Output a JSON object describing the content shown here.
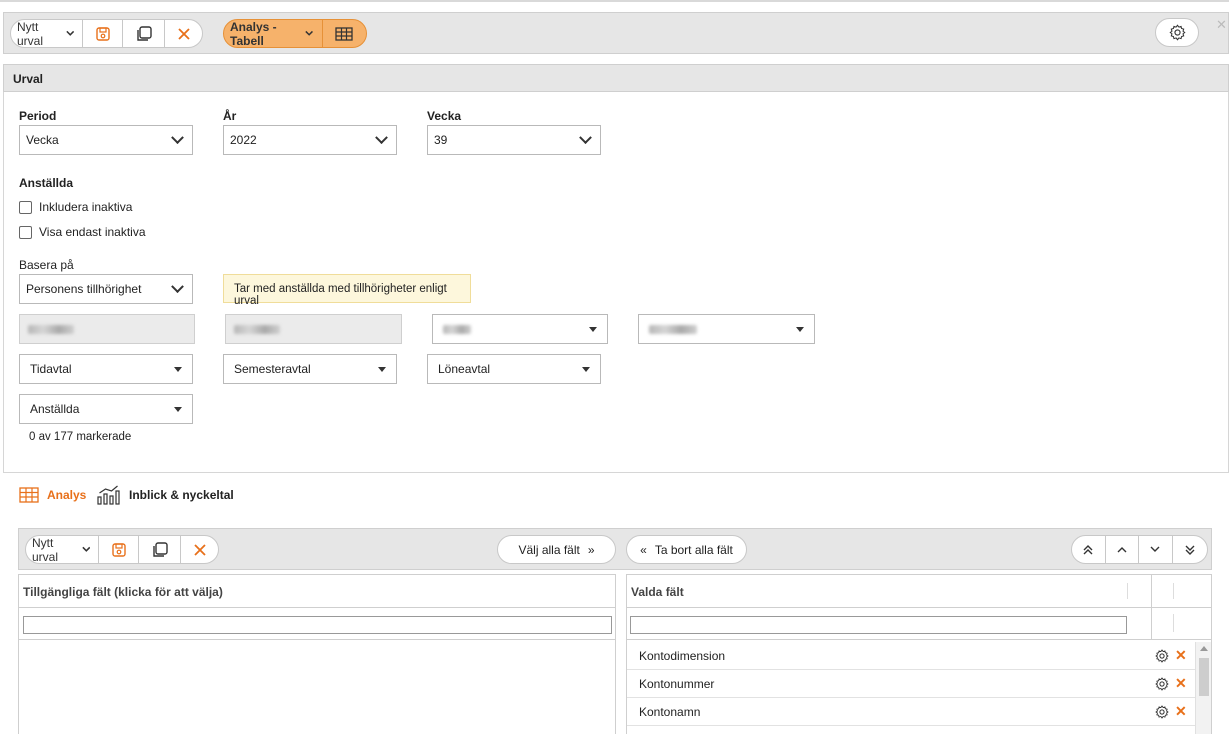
{
  "toolbar": {
    "selection_select": "Nytt urval",
    "view_select": "Analys - Tabell"
  },
  "urval": {
    "title": "Urval",
    "period": {
      "label": "Period",
      "value": "Vecka"
    },
    "year": {
      "label": "År",
      "value": "2022"
    },
    "week": {
      "label": "Vecka",
      "value": "39"
    },
    "employees_heading": "Anställda",
    "include_inactive": "Inkludera inaktiva",
    "only_inactive": "Visa endast inaktiva",
    "base_on": {
      "label": "Basera på",
      "value": "Personens tillhörighet"
    },
    "hint": "Tar med anställda med tillhörigheter enligt urval",
    "time_agreement": "Tidavtal",
    "vacation_agreement": "Semesteravtal",
    "salary_agreement": "Löneavtal",
    "employees_select": "Anställda",
    "marked_count": "0 av 177 markerade"
  },
  "tabs": {
    "analysis": "Analys",
    "insight": "Inblick & nyckeltal"
  },
  "fields_toolbar": {
    "selection_select": "Nytt urval",
    "select_all": "Välj alla fält",
    "remove_all": "Ta bort alla fält"
  },
  "available": {
    "header": "Tillgängliga fält (klicka för att välja)"
  },
  "selected": {
    "header": "Valda fält",
    "rows": [
      "Kontodimension",
      "Kontonummer",
      "Kontonamn"
    ]
  },
  "colors": {
    "accent": "#e8701a",
    "orange_button": "#f6b26b"
  },
  "icons": [
    "save-icon",
    "copy-icon",
    "close-icon",
    "table-icon",
    "gear-icon",
    "chart-icon",
    "chevron-double-up-icon",
    "chevron-up-icon",
    "chevron-down-icon",
    "chevron-double-down-icon"
  ]
}
